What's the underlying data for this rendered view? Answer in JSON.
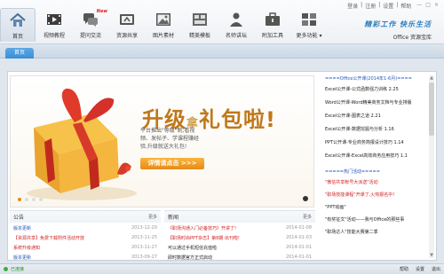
{
  "window": {
    "links": [
      "登录",
      "|",
      "注册",
      "|",
      "设置",
      "|",
      "帮助"
    ],
    "min": "—",
    "max": "□",
    "close": "×"
  },
  "nav": [
    {
      "label": "首页",
      "icon": "home-icon"
    },
    {
      "label": "视频教程",
      "icon": "video-icon"
    },
    {
      "label": "提问交流",
      "icon": "chat-icon",
      "badge": "New"
    },
    {
      "label": "资源共享",
      "icon": "share-icon"
    },
    {
      "label": "图片素材",
      "icon": "image-icon"
    },
    {
      "label": "精美模板",
      "icon": "template-icon"
    },
    {
      "label": "名师讲坛",
      "icon": "teacher-icon"
    },
    {
      "label": "附加工具",
      "icon": "tools-icon"
    },
    {
      "label": "更多功能 ▾",
      "icon": "more-icon"
    }
  ],
  "brand": {
    "slogan": "精彩工作  快乐生活",
    "sub": "Office 资源宝库"
  },
  "tab": {
    "label": "首页"
  },
  "banner": {
    "title_pre": "升级",
    "title_accent": "拿",
    "title_post": "礼包啦!",
    "text": "平台推出\"等级\"制,看视频、发帖子、学课程赚经验,升级就送大礼包!",
    "button": "详情请点击 >>>"
  },
  "right_panel": {
    "head1": "====Office公开课(2014年1-6月)====",
    "list1": [
      "Excel公开课-公式函数强力训练 2.25",
      "Word公开课-Word精美商务文档与专业排版",
      "Excel公开课-图表之道 2.21",
      "Excel公开课-数据挖掘与分析 1.16",
      "PPT公开课-专业商务简报设计技巧 1.14",
      "Excel公开课-Excel高效商务应用技巧 1.1"
    ],
    "head2": "=====热门活动=====",
    "list2": [
      {
        "text": "\"微信共享帐号大派送\"活动",
        "cls": "red"
      },
      {
        "text": "\"职场技能课程\"开课了,火热报名中!",
        "cls": "red"
      },
      {
        "text": "\"PPT动画\"",
        "cls": "dark"
      },
      {
        "text": "\"有奖征文\"活动——我与Office的那些事",
        "cls": "dark"
      },
      {
        "text": "\"职场达人\"技能大赛第二季",
        "cls": "dark"
      }
    ]
  },
  "notice": {
    "title": "公告",
    "more": "更多",
    "items": [
      {
        "text": "版本更新",
        "date": "2013-12-20",
        "cls": "c-blue"
      },
      {
        "text": "【资源共享】免费下载附件活动开放",
        "date": "2013-11-25",
        "cls": "c-red"
      },
      {
        "text": "系统升级通知",
        "date": "2013-11-27",
        "cls": "c-red"
      },
      {
        "text": "版本更新",
        "date": "2013-09-27",
        "cls": "c-blue"
      }
    ]
  },
  "news": {
    "title": "新闻",
    "more": "更多",
    "items": [
      {
        "text": "《职场沟通入门必备技巧》开讲了!",
        "date": "2014-01-08",
        "cls": "c-red"
      },
      {
        "text": "【职场时尚PPT杂志】第8期 出刊啦!",
        "date": "2014-01-03",
        "cls": "c-red"
      },
      {
        "text": "可以通过手机短信充值啦",
        "date": "2014-01-01",
        "cls": "c-dark"
      },
      {
        "text": "即时数据官方正式启动",
        "date": "2014-01-01",
        "cls": "c-dark"
      }
    ]
  },
  "status": {
    "left": "已连接",
    "items": [
      "帮助",
      "设置",
      "退出"
    ]
  }
}
